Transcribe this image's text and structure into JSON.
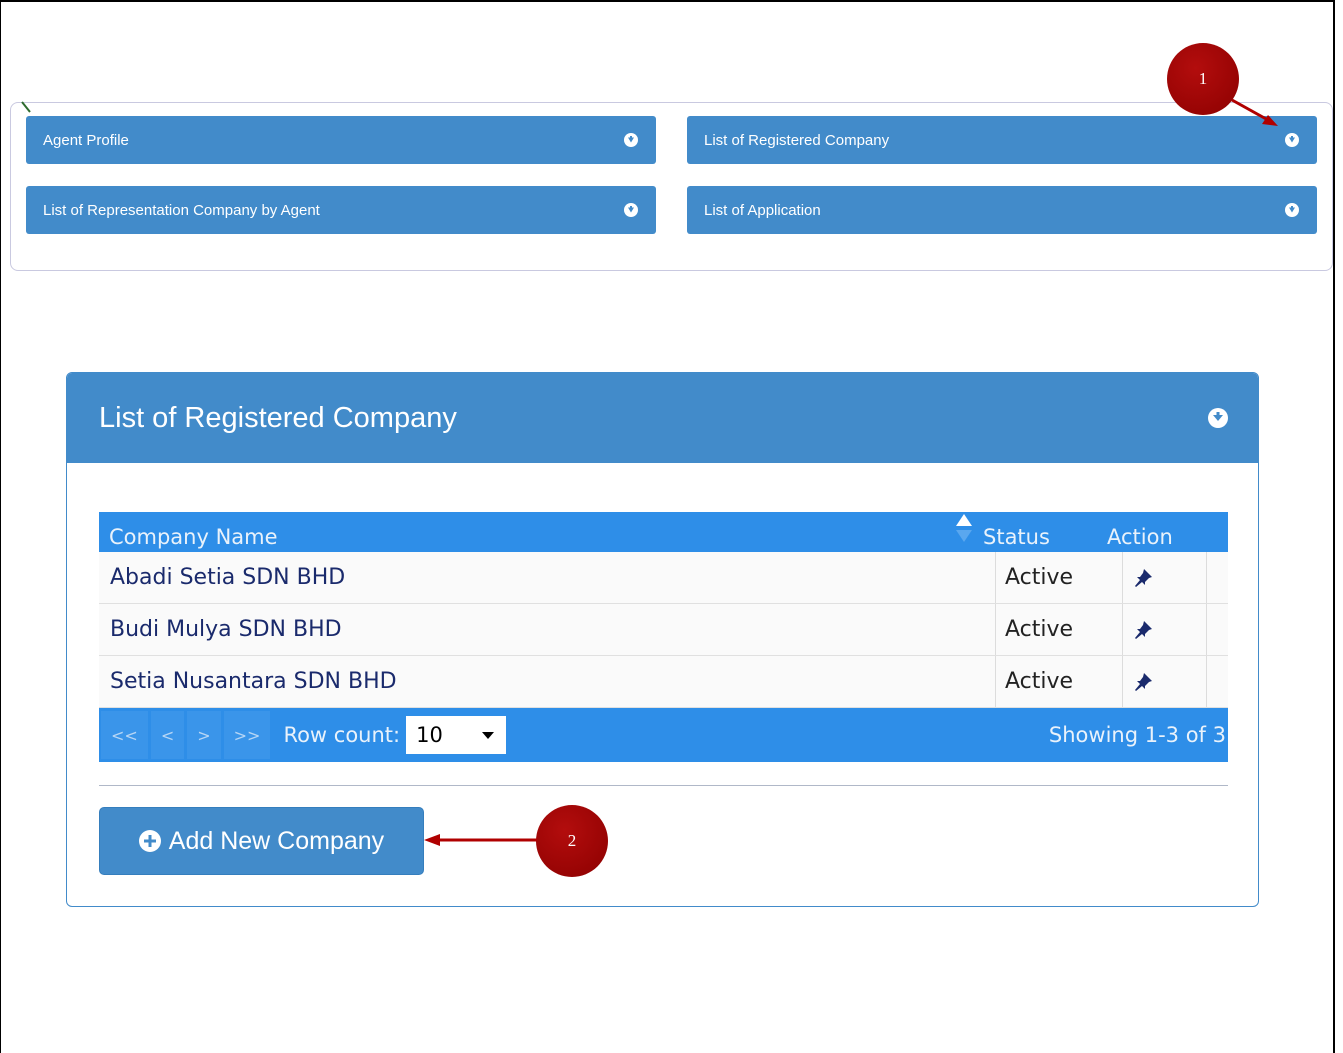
{
  "accordion": {
    "items": [
      {
        "label": "Agent Profile",
        "icon": "circle-arrow-down-icon"
      },
      {
        "label": "List of Registered Company",
        "icon": "circle-arrow-down-icon"
      },
      {
        "label": "List of Representation Company by Agent",
        "icon": "circle-arrow-down-icon"
      },
      {
        "label": "List of Application",
        "icon": "circle-arrow-down-icon"
      }
    ]
  },
  "callouts": {
    "first": "1",
    "second": "2"
  },
  "card": {
    "title": "List of Registered Company",
    "table": {
      "columns": [
        "Company Name",
        "Status",
        "Action"
      ],
      "rows": [
        {
          "name": "Abadi Setia SDN BHD",
          "status": "Active",
          "action_icon": "pin-icon"
        },
        {
          "name": "Budi Mulya SDN BHD",
          "status": "Active",
          "action_icon": "pin-icon"
        },
        {
          "name": "Setia Nusantara SDN BHD",
          "status": "Active",
          "action_icon": "pin-icon"
        }
      ]
    },
    "pager": {
      "first": "<<",
      "prev": "<",
      "next": ">",
      "last": ">>",
      "row_count_label": "Row count:",
      "row_count_value": "10",
      "showing": "Showing 1-3 of 3"
    },
    "add_button_label": "Add New Company"
  },
  "colors": {
    "primary": "#428bca",
    "grid_blue": "#2e8ee8",
    "callout_red": "#a50000"
  }
}
